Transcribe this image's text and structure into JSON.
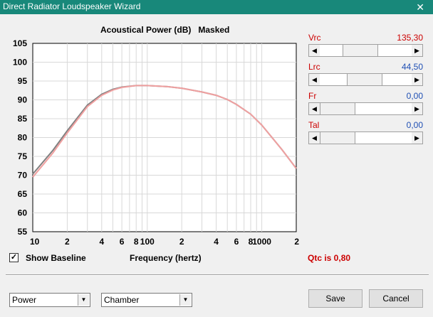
{
  "window": {
    "title": "Direct Radiator Loudspeaker Wizard",
    "close_glyph": "✕"
  },
  "chart_header": {
    "title": "Acoustical Power (dB)   Masked"
  },
  "chart_data": {
    "type": "line",
    "xscale": "log",
    "xlim": [
      10,
      2000
    ],
    "ylim": [
      55,
      105
    ],
    "yticks": [
      55,
      60,
      65,
      70,
      75,
      80,
      85,
      90,
      95,
      100,
      105
    ],
    "xtick_labels": [
      {
        "value": 10,
        "label": "10"
      },
      {
        "value": 20,
        "label": "2"
      },
      {
        "value": 40,
        "label": "4"
      },
      {
        "value": 60,
        "label": "6"
      },
      {
        "value": 80,
        "label": "8"
      },
      {
        "value": 100,
        "label": "100"
      },
      {
        "value": 200,
        "label": "2"
      },
      {
        "value": 400,
        "label": "4"
      },
      {
        "value": 600,
        "label": "6"
      },
      {
        "value": 800,
        "label": "8"
      },
      {
        "value": 1000,
        "label": "1000"
      },
      {
        "value": 2000,
        "label": "2"
      }
    ],
    "grid": true,
    "series": [
      {
        "color": "#808080",
        "x": [
          10,
          15,
          20,
          30,
          40,
          50,
          60,
          80,
          100,
          150,
          200,
          300,
          400,
          500,
          600,
          800,
          1000,
          1500,
          2000
        ],
        "y": [
          70.3,
          76.6,
          81.8,
          88.6,
          91.5,
          92.8,
          93.4,
          93.8,
          93.8,
          93.5,
          93.1,
          92.1,
          91.2,
          90.1,
          88.8,
          86.2,
          83.3,
          76.8,
          71.8
        ]
      },
      {
        "color": "#f0a0a0",
        "x": [
          10,
          15,
          20,
          30,
          40,
          50,
          60,
          80,
          100,
          150,
          200,
          300,
          400,
          500,
          600,
          800,
          1000,
          1500,
          2000
        ],
        "y": [
          69.5,
          75.9,
          81.2,
          88.2,
          91.2,
          92.6,
          93.3,
          93.8,
          93.8,
          93.5,
          93.1,
          92.1,
          91.2,
          90.1,
          88.8,
          86.2,
          83.3,
          76.8,
          71.8
        ]
      }
    ]
  },
  "params": [
    {
      "label": "Vrc",
      "value": "135,30",
      "value_color": "#cc0000",
      "thumb_fraction": 0.4
    },
    {
      "label": "Lrc",
      "value": "44,50",
      "value_color": "#1f4fb4",
      "thumb_fraction": 0.48
    },
    {
      "label": "Fr",
      "value": "0,00",
      "value_color": "#1f4fb4",
      "thumb_fraction": 0.0
    },
    {
      "label": "Tal",
      "value": "0,00",
      "value_color": "#1f4fb4",
      "thumb_fraction": 0.0
    }
  ],
  "show_baseline": {
    "label": "Show Baseline",
    "checked": true,
    "check_glyph": "✓"
  },
  "xaxis_label": "Frequency (hertz)",
  "qtc_text": "Qtc is 0,80",
  "selects": {
    "left": "Power",
    "right": "Chamber",
    "arrow_glyph": "▼"
  },
  "buttons": {
    "save": "Save",
    "cancel": "Cancel"
  },
  "scroll_arrows": {
    "left": "◀",
    "right": "▶"
  }
}
